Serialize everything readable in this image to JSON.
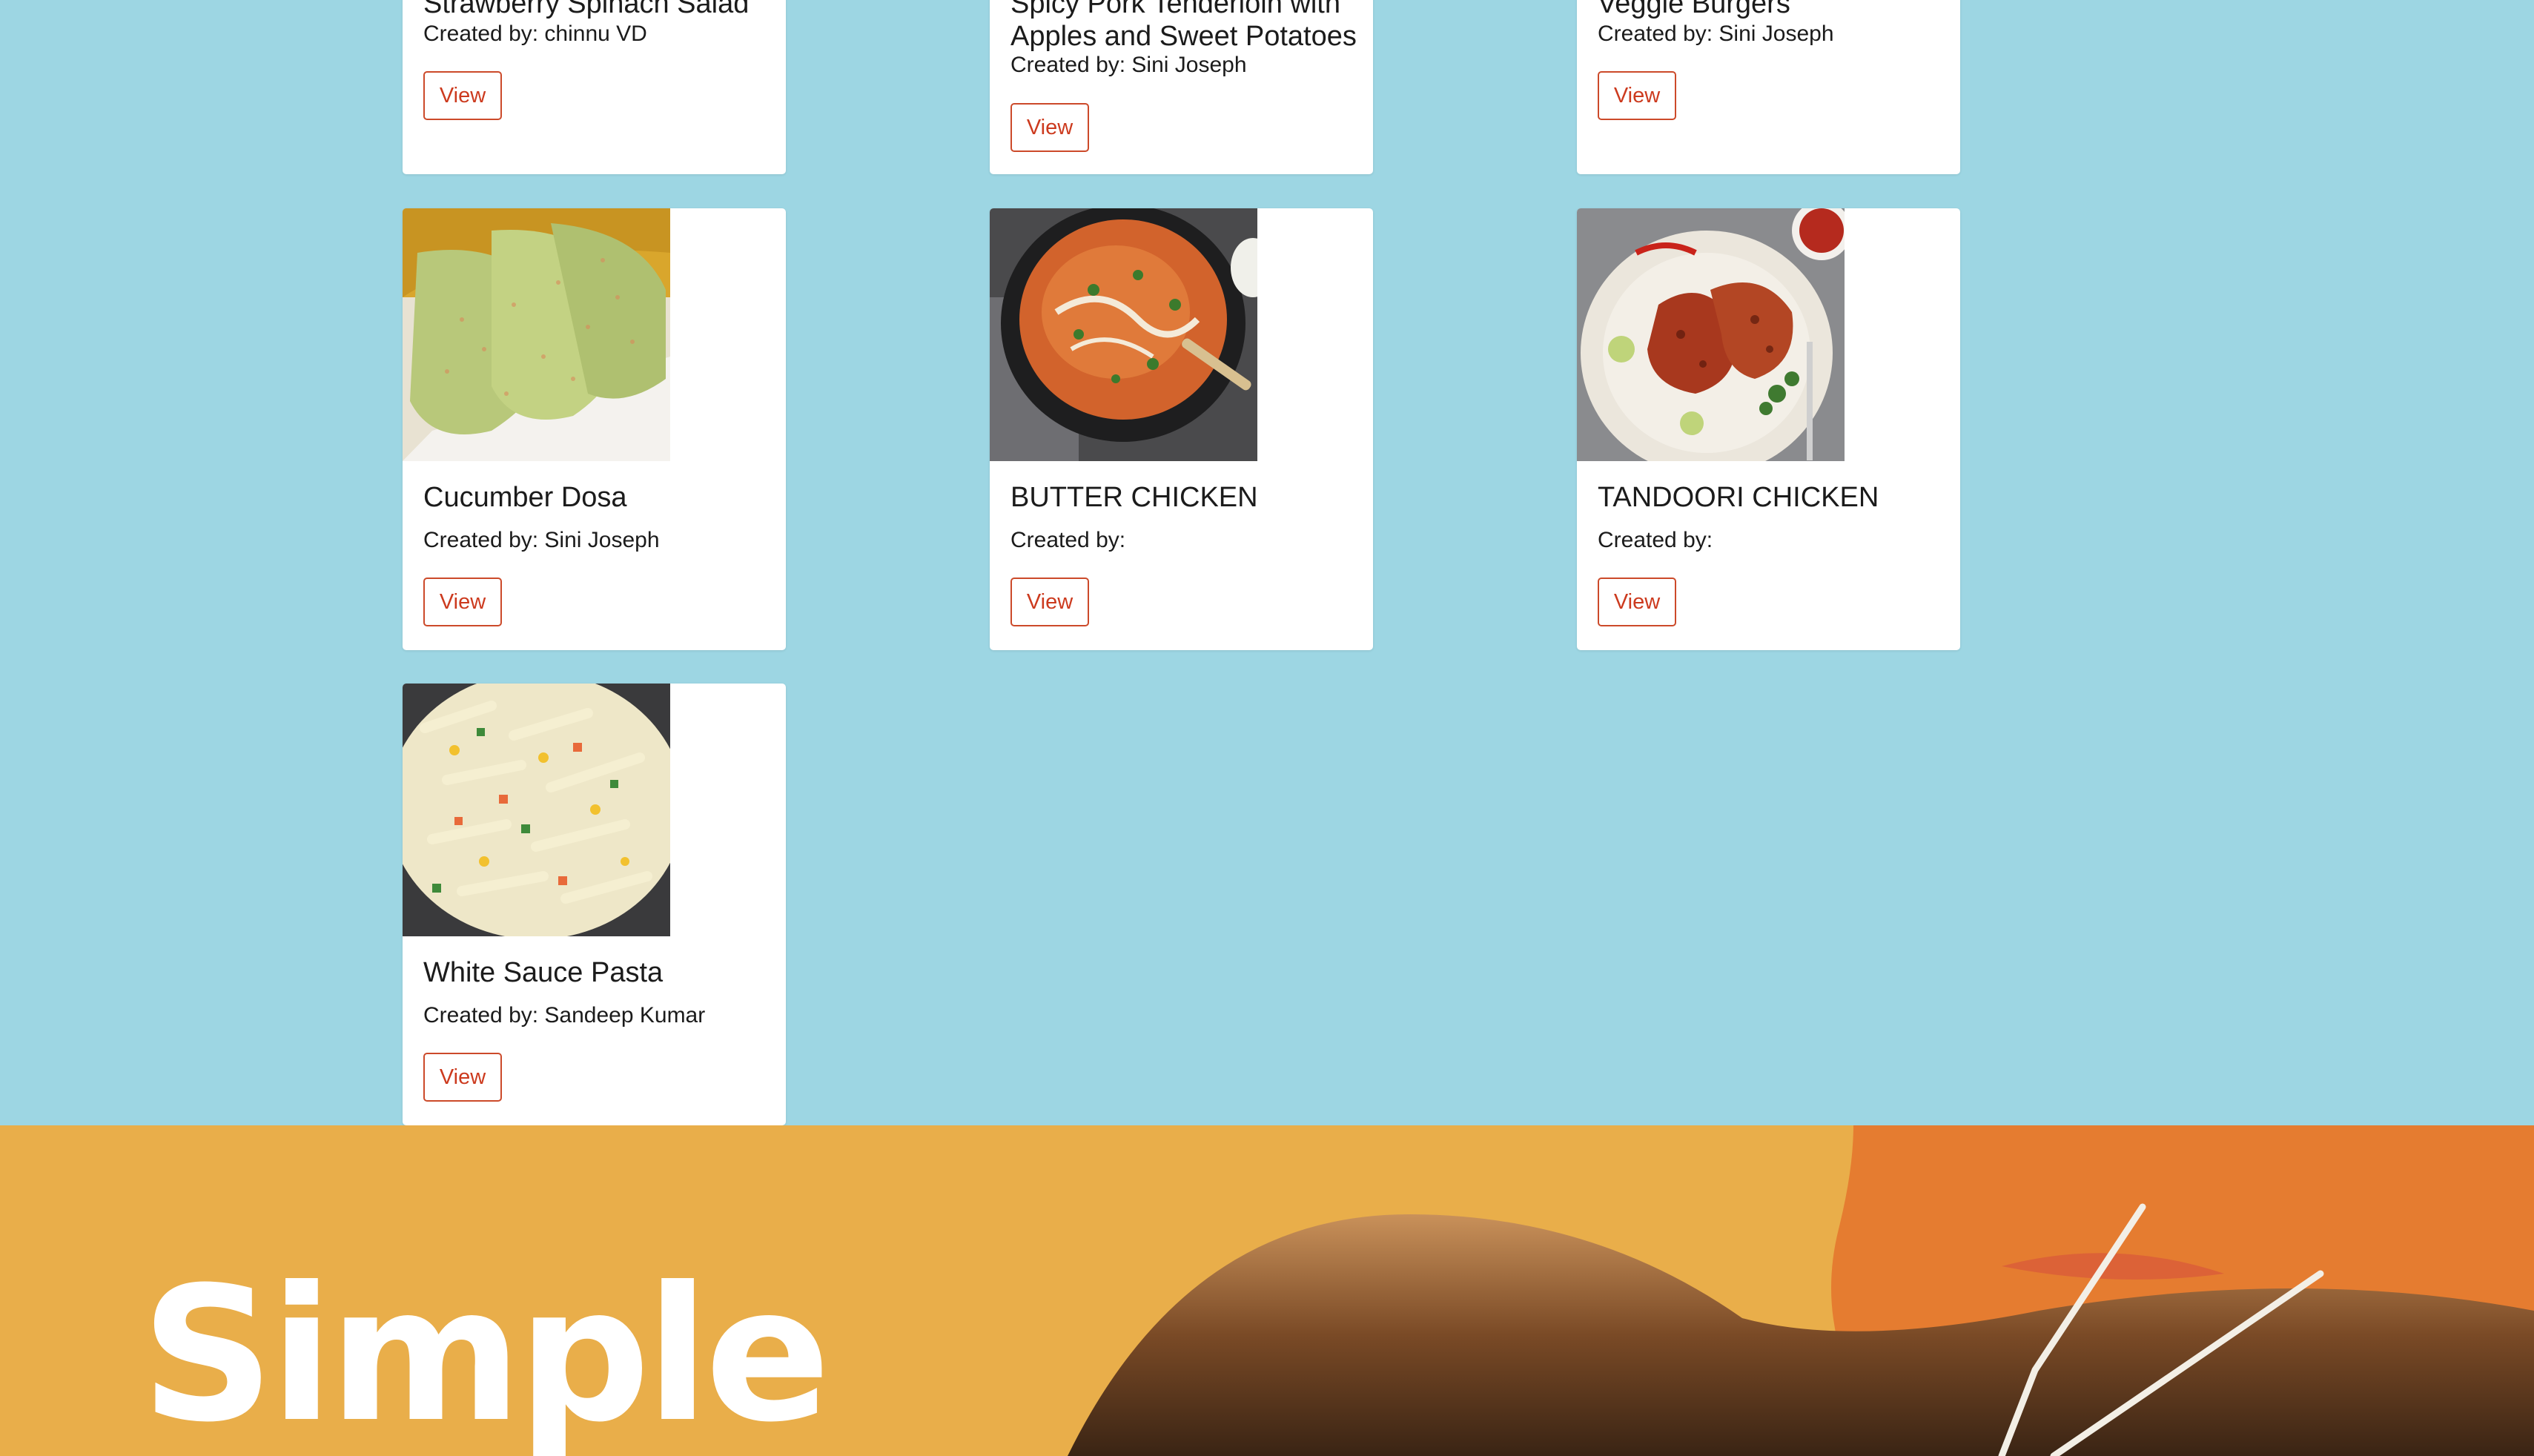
{
  "recipes": [
    {
      "title": "Strawberry Spinach Salad",
      "creator": "Created by: chinnu VD",
      "view_label": "View"
    },
    {
      "title_line1": "Spicy Pork Tenderloin with",
      "title_line2": "Apples and Sweet Potatoes",
      "creator": "Created by: Sini Joseph",
      "view_label": "View"
    },
    {
      "title": "Veggie Burgers",
      "creator": "Created by: Sini Joseph",
      "view_label": "View"
    },
    {
      "title": "Cucumber Dosa",
      "creator": "Created by: Sini Joseph",
      "view_label": "View",
      "image": "cucumber-dosa-photo"
    },
    {
      "title": "BUTTER CHICKEN",
      "creator": "Created by:",
      "view_label": "View",
      "image": "butter-chicken-photo"
    },
    {
      "title": "TANDOORI CHICKEN",
      "creator": "Created by:",
      "view_label": "View",
      "image": "tandoori-chicken-photo"
    },
    {
      "title": "White Sauce Pasta",
      "creator": "Created by: Sandeep Kumar",
      "view_label": "View",
      "image": "white-sauce-pasta-photo"
    }
  ],
  "footer": {
    "heading": "Simple",
    "image": "food-photo-banner"
  },
  "colors": {
    "page_background": "#9dd6e3",
    "card_background": "#ffffff",
    "accent": "#cc3a1e",
    "footer_background": "#e9ae4a",
    "footer_blob": "#e57c30"
  }
}
